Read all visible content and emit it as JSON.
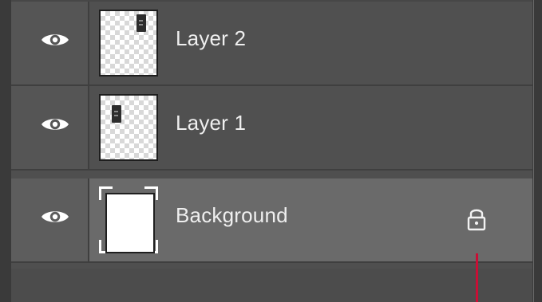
{
  "panel": {
    "name": "layers-panel"
  },
  "layers": [
    {
      "id": "layer-2",
      "name": "Layer 2",
      "visible": true,
      "selected": false,
      "locked": false,
      "thumbnail": "transparent-layer-with-small-dark-object-upper-right"
    },
    {
      "id": "layer-1",
      "name": "Layer 1",
      "visible": true,
      "selected": false,
      "locked": false,
      "thumbnail": "transparent-layer-with-small-dark-object-upper-left"
    },
    {
      "id": "background",
      "name": "Background",
      "visible": true,
      "selected": true,
      "locked": true,
      "thumbnail": "white-background"
    }
  ],
  "icons": {
    "visibility": "eye-icon",
    "lock": "lock-icon"
  },
  "colors": {
    "panel_bg": "#4f4f4f",
    "selected_row": "#6a6a6a",
    "text": "#efefef",
    "accent_line": "#c90f35"
  }
}
